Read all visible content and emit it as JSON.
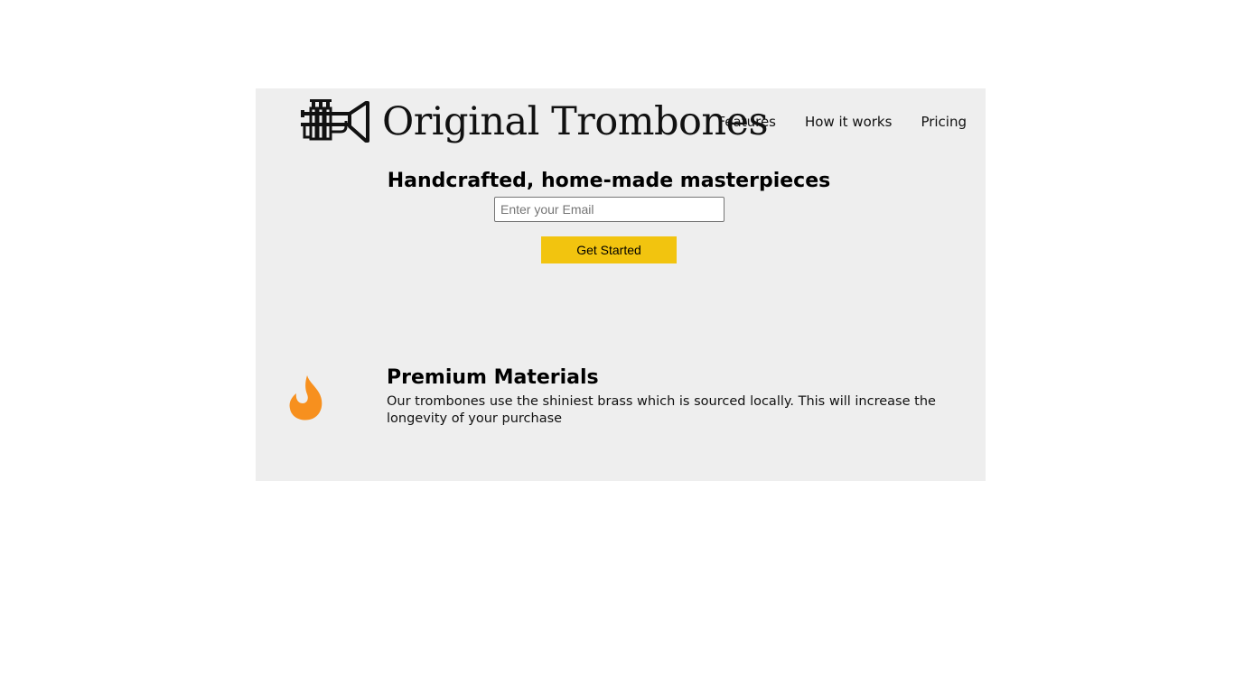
{
  "header": {
    "logo_text": "Original Trombones",
    "logo_icon": "trumpet-icon",
    "nav": [
      {
        "label": "Features"
      },
      {
        "label": "How it works"
      },
      {
        "label": "Pricing"
      }
    ]
  },
  "hero": {
    "title": "Handcrafted, home-made masterpieces",
    "email_placeholder": "Enter your Email",
    "button_label": "Get Started",
    "button_color": "#f2c40f"
  },
  "feature": {
    "icon": "flame-icon",
    "icon_color": "#f7901e",
    "title": "Premium Materials",
    "description": "Our trombones use the shiniest brass which is sourced locally. This will increase the longevity of your purchase"
  },
  "colors": {
    "page_background": "#eeeeee",
    "body_background": "#ffffff"
  }
}
